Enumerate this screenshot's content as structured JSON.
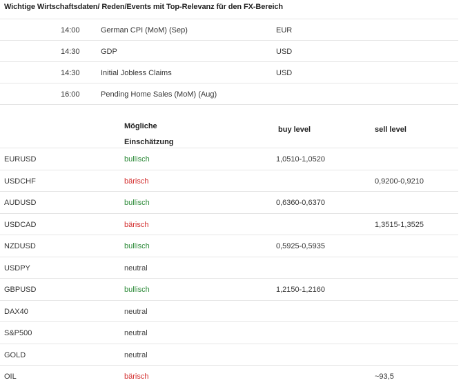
{
  "heading": "Wichtige Wirtschaftsdaten/ Reden/Events mit Top-Relevanz für den FX-Bereich",
  "events": [
    {
      "time": "14:00",
      "name": "German CPI (MoM) (Sep)",
      "currency": "EUR"
    },
    {
      "time": "14:30",
      "name": "GDP",
      "currency": "USD"
    },
    {
      "time": "14:30",
      "name": "Initial Jobless Claims",
      "currency": "USD"
    },
    {
      "time": "16:00",
      "name": "Pending Home Sales (MoM) (Aug)",
      "currency": ""
    }
  ],
  "fx_table": {
    "headers": {
      "estimate_line1": "Mögliche",
      "estimate_line2": "Einschätzung",
      "buy": "buy level",
      "sell": "sell level"
    },
    "colors": {
      "bullisch": "#2e8b3a",
      "bärisch": "#d32f2f",
      "neutral": "#444444"
    },
    "rows": [
      {
        "pair": "EURUSD",
        "estimate": "bullisch",
        "buy": "1,0510-1,0520",
        "sell": ""
      },
      {
        "pair": "USDCHF",
        "estimate": "bärisch",
        "buy": "",
        "sell": "0,9200-0,9210"
      },
      {
        "pair": "AUDUSD",
        "estimate": "bullisch",
        "buy": "0,6360-0,6370",
        "sell": ""
      },
      {
        "pair": "USDCAD",
        "estimate": "bärisch",
        "buy": "",
        "sell": "1,3515-1,3525"
      },
      {
        "pair": "NZDUSD",
        "estimate": "bullisch",
        "buy": "0,5925-0,5935",
        "sell": ""
      },
      {
        "pair": "USDPY",
        "estimate": "neutral",
        "buy": "",
        "sell": ""
      },
      {
        "pair": "GBPUSD",
        "estimate": "bullisch",
        "buy": "1,2150-1,2160",
        "sell": ""
      },
      {
        "pair": "DAX40",
        "estimate": "neutral",
        "buy": "",
        "sell": ""
      },
      {
        "pair": "S&P500",
        "estimate": "neutral",
        "buy": "",
        "sell": ""
      },
      {
        "pair": "GOLD",
        "estimate": "neutral",
        "buy": "",
        "sell": ""
      },
      {
        "pair": "OIL",
        "estimate": "bärisch",
        "buy": "",
        "sell": "~93,5"
      }
    ]
  }
}
